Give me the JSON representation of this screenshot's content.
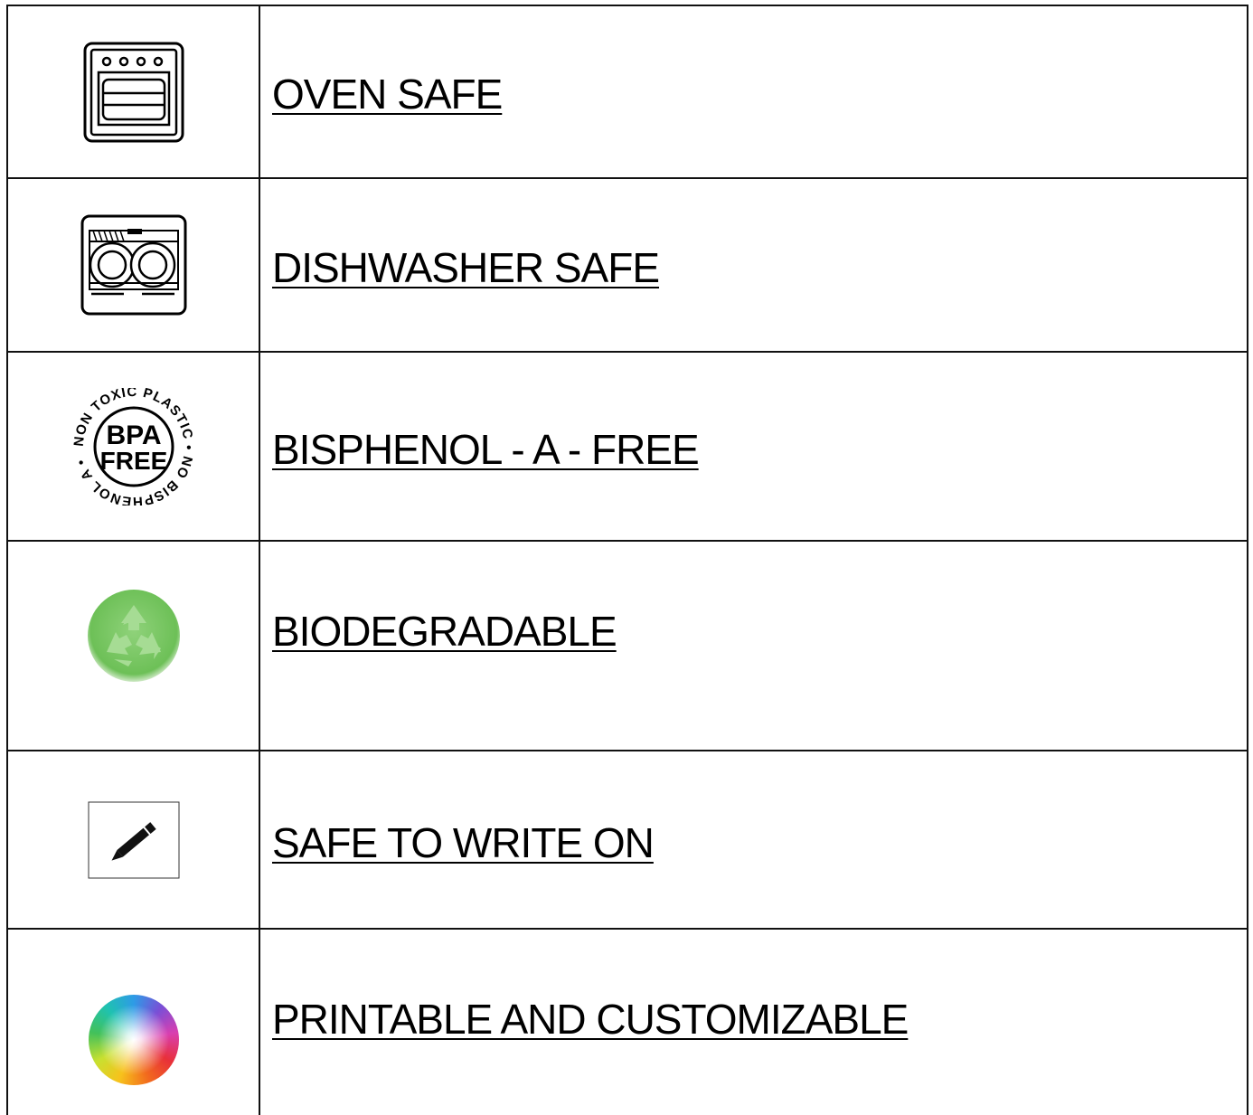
{
  "rows": [
    {
      "label": "OVEN SAFE",
      "icon": "oven-icon"
    },
    {
      "label": "DISHWASHER SAFE",
      "icon": "dishwasher-icon"
    },
    {
      "label": "BISPHENOL - A - FREE",
      "icon": "bpa-free-seal-icon"
    },
    {
      "label": "BIODEGRADABLE",
      "icon": "recycle-icon"
    },
    {
      "label": "SAFE TO WRITE ON",
      "icon": "pencil-icon"
    },
    {
      "label": "PRINTABLE AND CUSTOMIZABLE",
      "icon": "color-wheel-icon"
    }
  ],
  "bpa_seal": {
    "ring_text": "NON TOXIC PLASTIC • NO BISPHENOL A •",
    "line1": "BPA",
    "line2": "FREE"
  },
  "colors": {
    "border": "#111111",
    "text": "#000000",
    "recycle_green": "#6dc057"
  }
}
